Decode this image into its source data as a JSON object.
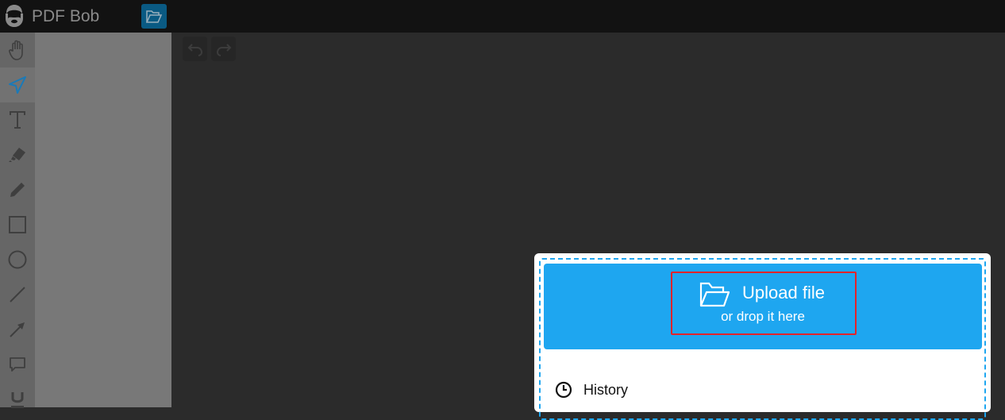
{
  "app": {
    "title": "PDF Bob",
    "logo_icon": "bearded-face-icon",
    "open_button_icon": "folder-open-icon"
  },
  "toolbar": {
    "tools": [
      {
        "name": "hand",
        "icon": "hand-icon",
        "active": false
      },
      {
        "name": "select",
        "icon": "cursor-arrow-icon",
        "active": true
      },
      {
        "name": "text",
        "icon": "text-icon",
        "active": false
      },
      {
        "name": "highlighter",
        "icon": "highlighter-icon",
        "active": false
      },
      {
        "name": "pencil",
        "icon": "pencil-icon",
        "active": false
      },
      {
        "name": "rectangle",
        "icon": "rectangle-icon",
        "active": false
      },
      {
        "name": "ellipse",
        "icon": "circle-icon",
        "active": false
      },
      {
        "name": "line",
        "icon": "line-icon",
        "active": false
      },
      {
        "name": "arrow",
        "icon": "arrow-icon",
        "active": false
      },
      {
        "name": "comment",
        "icon": "comment-icon",
        "active": false
      },
      {
        "name": "underline",
        "icon": "underline-icon",
        "active": false
      }
    ]
  },
  "history_controls": {
    "undo_icon": "undo-icon",
    "redo_icon": "redo-icon"
  },
  "upload": {
    "title": "Upload file",
    "subtitle": "or drop it here",
    "history_label": "History"
  },
  "colors": {
    "accent": "#1ea6f0",
    "active_tool": "#1a7ab8",
    "highlight": "#e3232a"
  }
}
